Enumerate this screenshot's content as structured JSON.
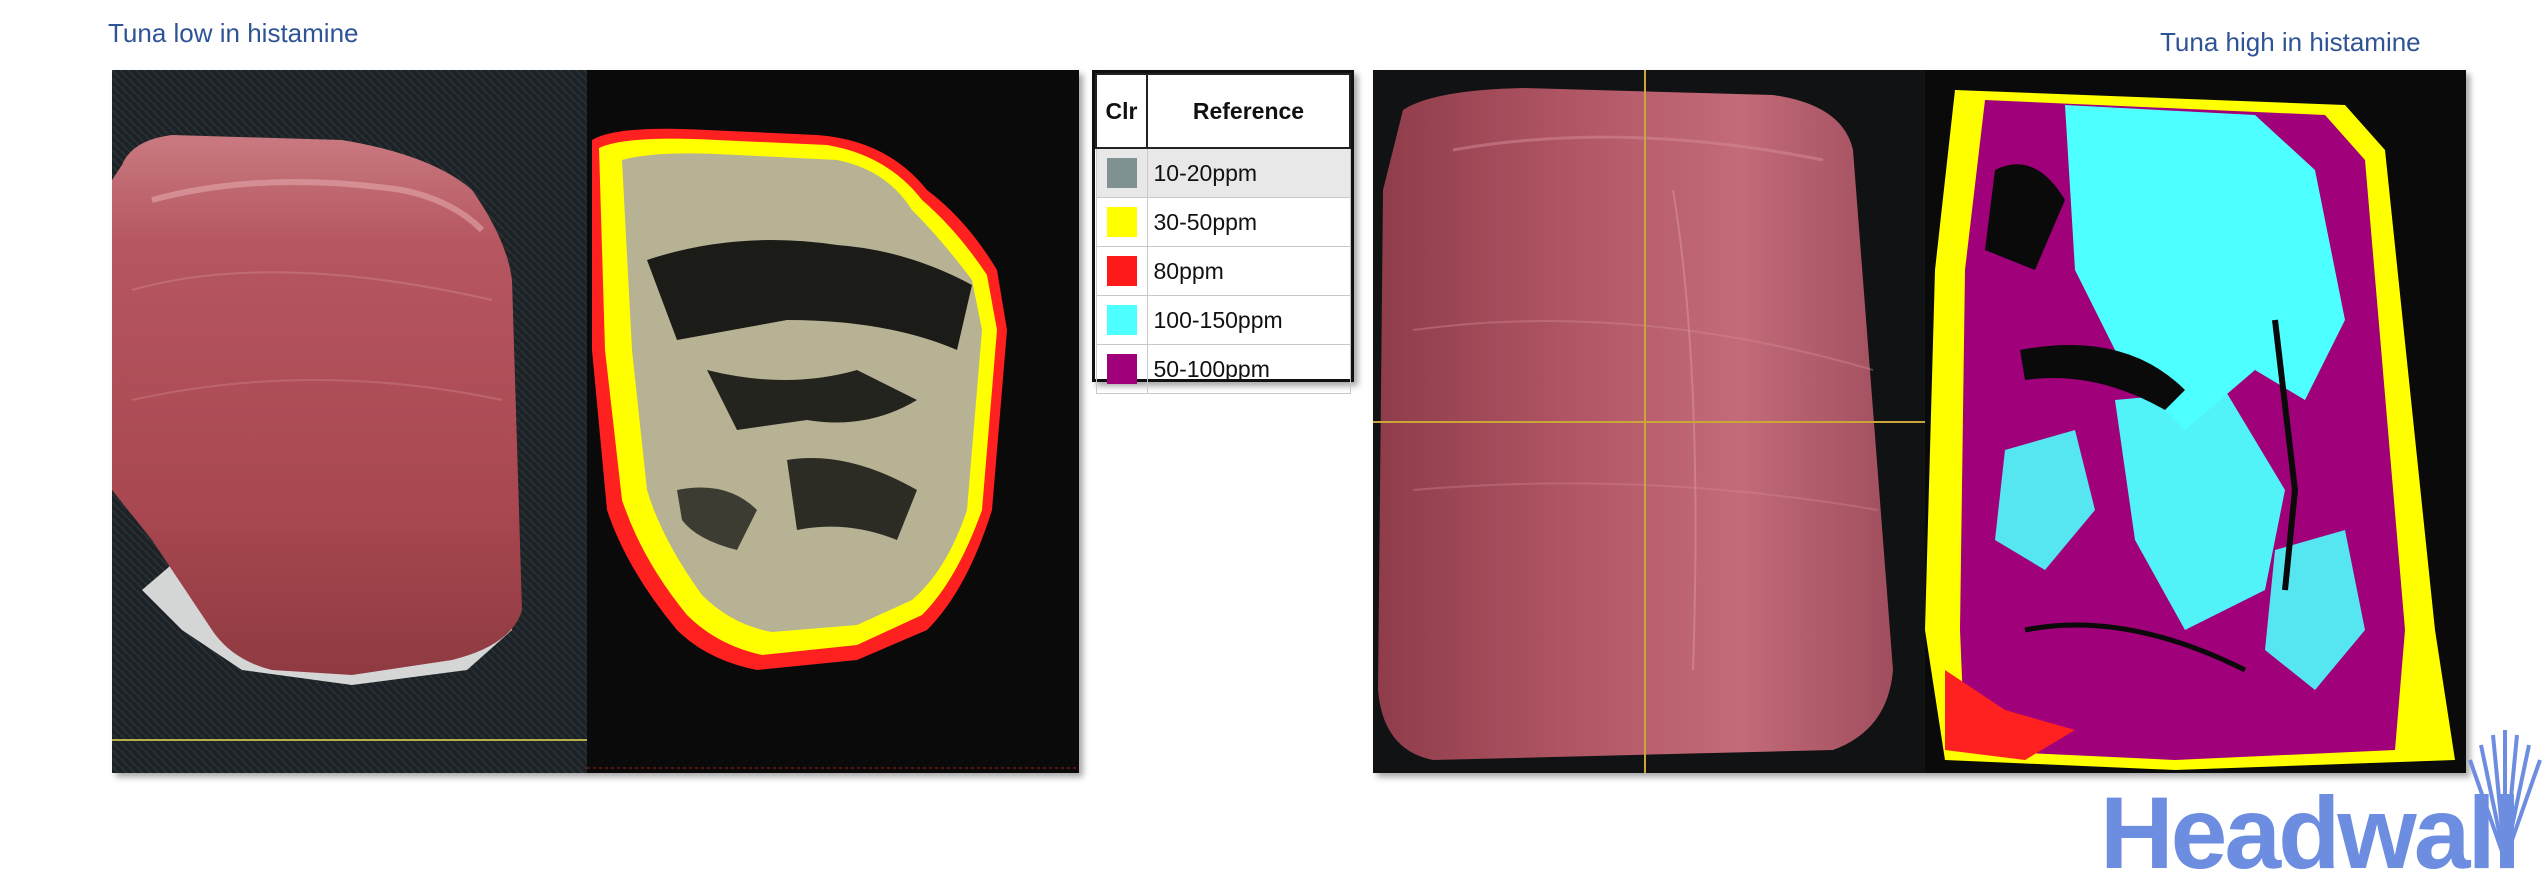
{
  "captions": {
    "left": "Tuna low in histamine",
    "right": "Tuna high in histamine"
  },
  "legend": {
    "headers": {
      "color": "Clr",
      "reference": "Reference"
    },
    "rows": [
      {
        "label": "10-20ppm",
        "color": "#7f9191",
        "selected": true
      },
      {
        "label": "30-50ppm",
        "color": "#ffff00",
        "selected": false
      },
      {
        "label": "80ppm",
        "color": "#ff1a1a",
        "selected": false
      },
      {
        "label": "100-150ppm",
        "color": "#4dffff",
        "selected": false
      },
      {
        "label": "50-100ppm",
        "color": "#a0007a",
        "selected": false
      }
    ]
  },
  "logo": {
    "text": "Headwall",
    "color": "#6d8de0"
  },
  "colors": {
    "caption": "#2f5496",
    "tuna_flesh": "#b84a55",
    "map_background": "#0a0a0a",
    "low_fill": "#b6b293"
  }
}
